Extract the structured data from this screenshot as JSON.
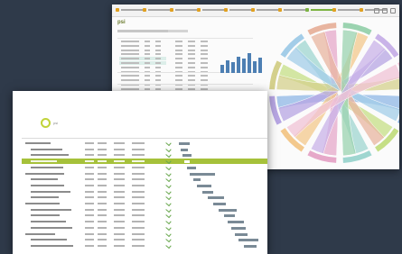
{
  "dashboard": {
    "logo": "psi",
    "tab_count": 10,
    "active_tab_index": 7,
    "bar_levels": [
      0.35,
      0.55,
      0.45,
      0.7,
      0.6,
      0.85,
      0.5,
      0.65
    ],
    "chord_colors": [
      "#8fb7e6",
      "#c5df86",
      "#9fd6d0",
      "#e6a8c9",
      "#f3c88c",
      "#b7a6e3",
      "#d4d08c",
      "#a3cde8",
      "#e8b5a0",
      "#9bd3b0",
      "#c9b3e8",
      "#f0c3d6"
    ],
    "accent_color": "#7cb342"
  },
  "gantt": {
    "logo_label": "psi",
    "selected_row_index": 3,
    "accent_color": "#a6c13a",
    "bar_color": "#7a8a96",
    "rows": 18
  }
}
